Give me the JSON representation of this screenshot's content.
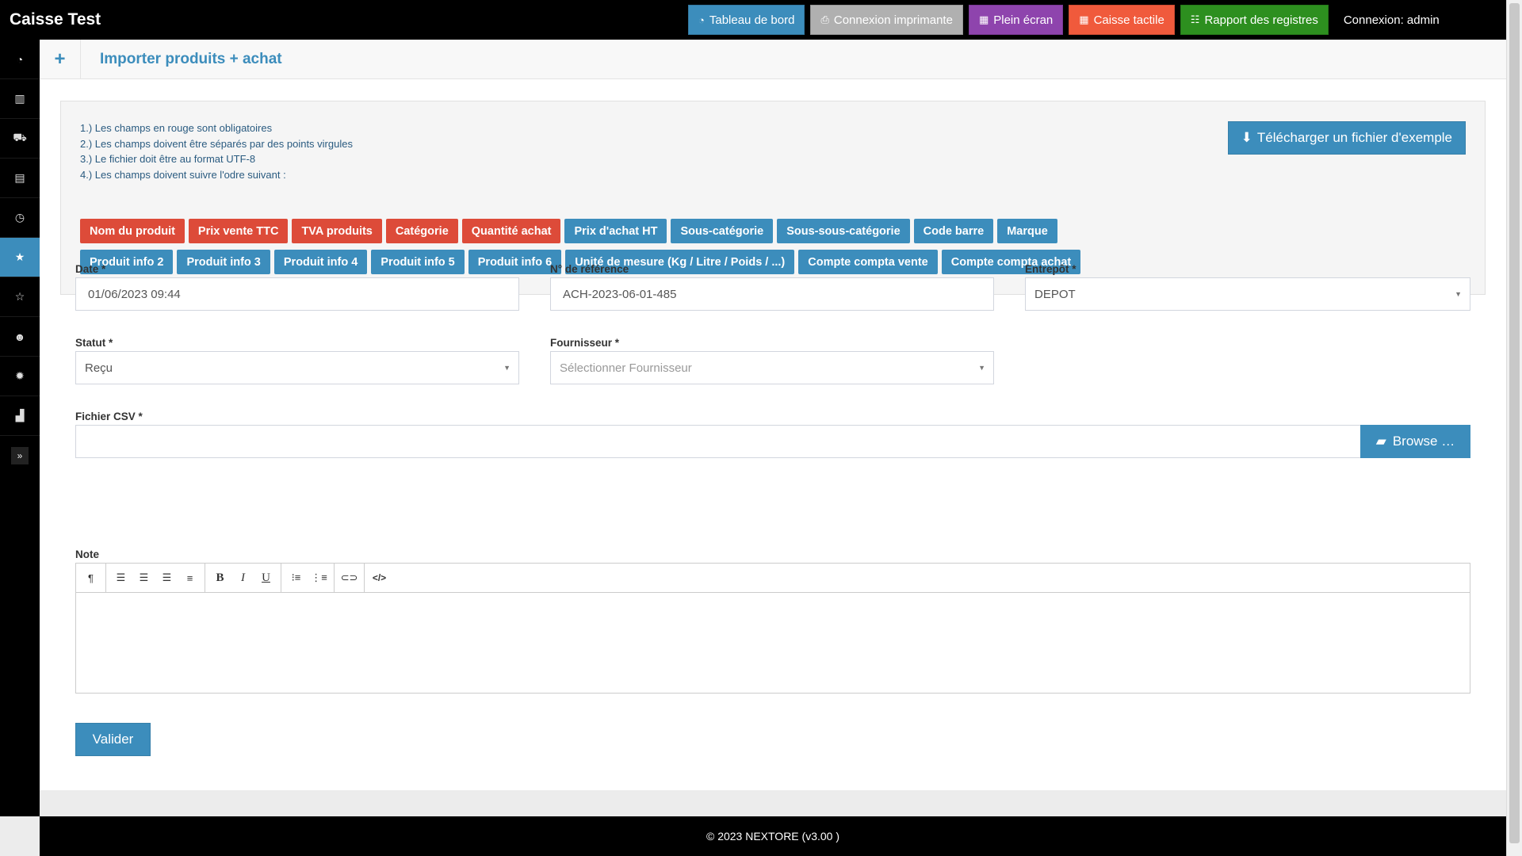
{
  "app": {
    "title": "Caisse Test",
    "login": "Connexion: admin"
  },
  "topbar": {
    "buttons": [
      {
        "label": "Tableau de bord",
        "icon": "dashboard-icon",
        "color": "#3c8dbc"
      },
      {
        "label": "Connexion imprimante",
        "icon": "printer-icon",
        "color": "#b0b0b0"
      },
      {
        "label": "Plein écran",
        "icon": "grid-icon",
        "color": "#8e44ad"
      },
      {
        "label": "Caisse tactile",
        "icon": "grid-icon",
        "color": "#f05a3c"
      },
      {
        "label": "Rapport des registres",
        "icon": "list-icon",
        "color": "#2d8f1f"
      }
    ]
  },
  "sidebar": {
    "items": [
      {
        "icon": "dashboard-icon",
        "glyph": "◔"
      },
      {
        "icon": "barcode-icon",
        "glyph": "▥"
      },
      {
        "icon": "cart-icon",
        "glyph": "⛟"
      },
      {
        "icon": "document-icon",
        "glyph": "▤"
      },
      {
        "icon": "clock-icon",
        "glyph": "◷"
      },
      {
        "icon": "star-icon",
        "glyph": "★"
      },
      {
        "icon": "star-outline-icon",
        "glyph": "☆"
      },
      {
        "icon": "users-icon",
        "glyph": "☻"
      },
      {
        "icon": "gear-icon",
        "glyph": "✹"
      },
      {
        "icon": "chart-icon",
        "glyph": "▟"
      }
    ],
    "toggle_glyph": "»"
  },
  "header": {
    "plus": "+",
    "title": "Importer produits + achat"
  },
  "info": {
    "instructions": [
      "1.) Les champs en rouge sont obligatoires",
      "2.) Les champs doivent être séparés par des points virgules",
      "3.) Le fichier doit être au format UTF-8",
      "4.) Les champs doivent suivre l'odre suivant :"
    ],
    "download_label": "Télécharger un fichier d'exemple",
    "tags_row1": [
      {
        "label": "Nom du produit",
        "required": true
      },
      {
        "label": "Prix vente TTC",
        "required": true
      },
      {
        "label": "TVA produits",
        "required": true
      },
      {
        "label": "Catégorie",
        "required": true
      },
      {
        "label": "Quantité achat",
        "required": true
      },
      {
        "label": "Prix d'achat HT",
        "required": false
      },
      {
        "label": "Sous-catégorie",
        "required": false
      },
      {
        "label": "Sous-sous-catégorie",
        "required": false
      },
      {
        "label": "Code barre",
        "required": false
      },
      {
        "label": "Marque",
        "required": false
      }
    ],
    "tags_row2": [
      {
        "label": "Produit info 2",
        "required": false
      },
      {
        "label": "Produit info 3",
        "required": false
      },
      {
        "label": "Produit info 4",
        "required": false
      },
      {
        "label": "Produit info 5",
        "required": false
      },
      {
        "label": "Produit info 6",
        "required": false
      },
      {
        "label": "Unité de mesure (Kg / Litre / Poids / ...)",
        "required": false
      },
      {
        "label": "Compte compta vente",
        "required": false
      },
      {
        "label": "Compte compta achat",
        "required": false
      }
    ]
  },
  "form": {
    "date_label": "Date *",
    "date_value": "01/06/2023 09:44",
    "ref_label": "N° de référence",
    "ref_value": "ACH-2023-06-01-485",
    "warehouse_label": "Entrepôt *",
    "warehouse_value": "DEPOT",
    "status_label": "Statut *",
    "status_value": "Reçu",
    "supplier_label": "Fournisseur *",
    "supplier_placeholder": "Sélectionner Fournisseur",
    "csv_label": "Fichier CSV *",
    "csv_value": "",
    "browse_label": "Browse …",
    "note_label": "Note",
    "submit_label": "Valider"
  },
  "footer": {
    "text": "© 2023 NEXTORE (v3.00 )"
  }
}
